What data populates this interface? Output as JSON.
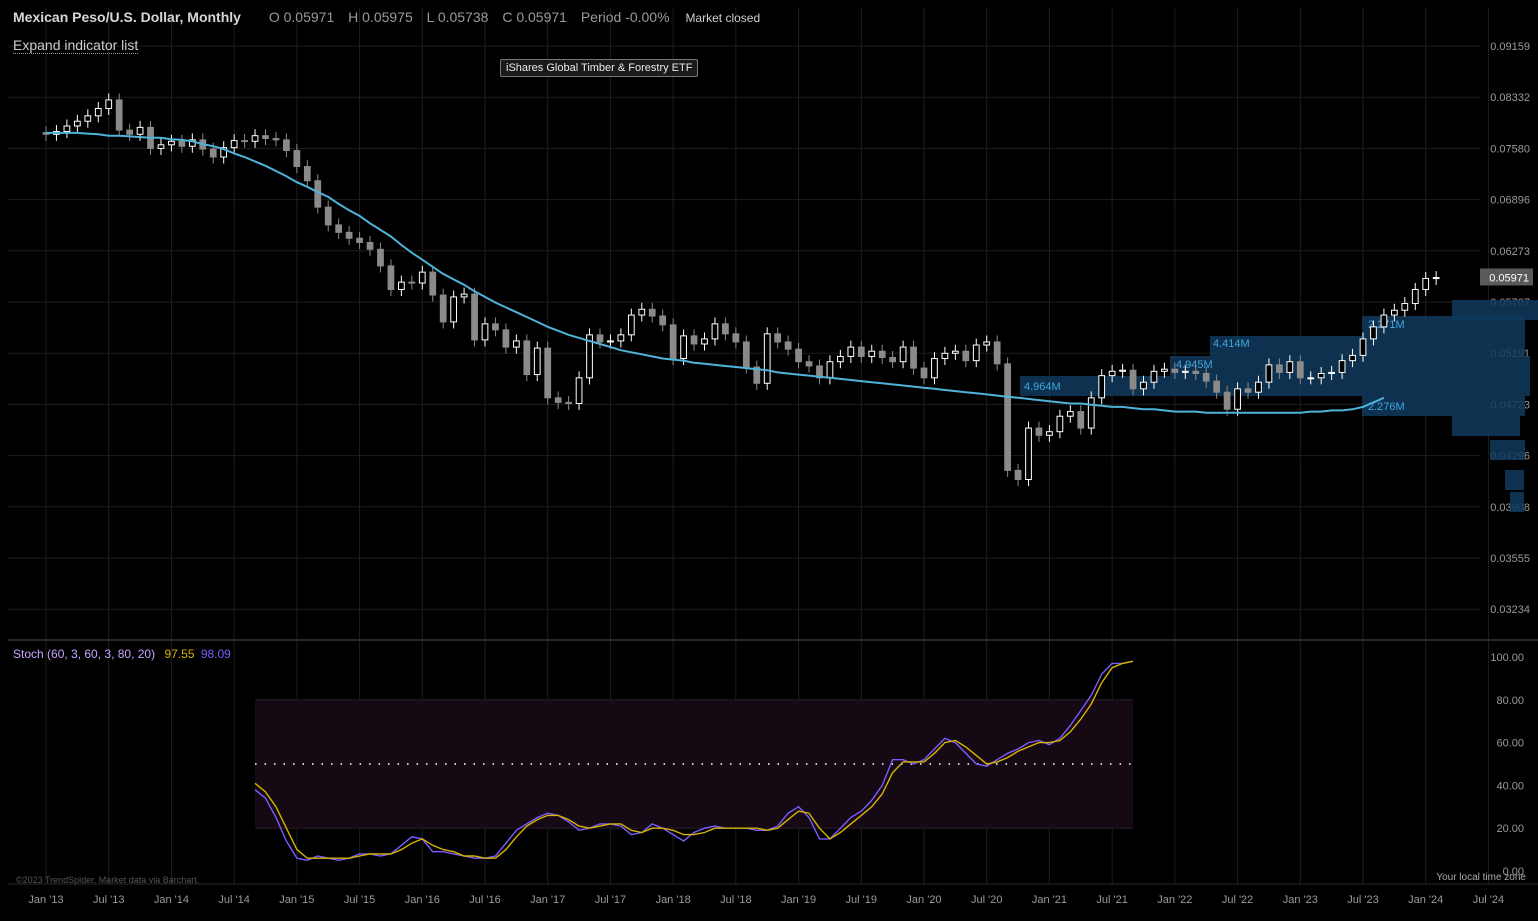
{
  "header": {
    "title": "Mexican Peso/U.S. Dollar, Monthly",
    "o_label": "O",
    "o_value": "0.05971",
    "h_label": "H",
    "h_value": "0.05975",
    "l_label": "L",
    "l_value": "0.05738",
    "c_label": "C",
    "c_value": "0.05971",
    "period_label": "Period",
    "period_value": "-0.00%",
    "status": "Market closed"
  },
  "expand_label": "Expand indicator list",
  "overlay_label": "iShares Global Timber & Forestry ETF",
  "last_price_tag": "0.05971",
  "stoch": {
    "label": "Stoch (60, 3, 60, 3, 80, 20)",
    "k": "97.55",
    "d": "98.09"
  },
  "footer": {
    "copyright": "©2023 TrendSpider. Market data via Barchart.",
    "timezone": "Your local time zone"
  },
  "colors": {
    "bull": "#ffffff",
    "bear": "#8a8a8a",
    "ma": "#4fb3d9",
    "stoch_k": "#7a5cff",
    "stoch_d": "#d8b400",
    "volume_profile": "#0f3a5c",
    "volume_label": "#3fa9e0",
    "grid": "#1e1e1e"
  },
  "chart_data": [
    {
      "type": "candlestick",
      "title": "Mexican Peso/U.S. Dollar, Monthly",
      "y_axis_ticks": [
        "0.09159",
        "0.08332",
        "0.07580",
        "0.06896",
        "0.06273",
        "0.05707",
        "0.05191",
        "0.04723",
        "0.04296",
        "0.03908",
        "0.03555",
        "0.03234"
      ],
      "y_scale": "log",
      "x_axis_ticks": [
        "Jan '13",
        "Jul '13",
        "Jan '14",
        "Jul '14",
        "Jan '15",
        "Jul '15",
        "Jan '16",
        "Jul '16",
        "Jan '17",
        "Jul '17",
        "Jan '18",
        "Jul '18",
        "Jan '19",
        "Jul '19",
        "Jan '20",
        "Jul '20",
        "Jan '21",
        "Jul '21",
        "Jan '22",
        "Jul '22",
        "Jan '23",
        "Jul '23",
        "Jan '24",
        "Jul '24"
      ],
      "close_series": [
        0.0778,
        0.0782,
        0.079,
        0.0797,
        0.0805,
        0.0816,
        0.0829,
        0.0784,
        0.0778,
        0.0788,
        0.0758,
        0.0763,
        0.0768,
        0.0761,
        0.077,
        0.0757,
        0.0746,
        0.0759,
        0.0769,
        0.0768,
        0.0776,
        0.0772,
        0.077,
        0.0755,
        0.0733,
        0.0714,
        0.068,
        0.0658,
        0.0649,
        0.0642,
        0.0637,
        0.0629,
        0.061,
        0.0584,
        0.0592,
        0.0591,
        0.0603,
        0.0578,
        0.055,
        0.0576,
        0.0579,
        0.0532,
        0.0548,
        0.0542,
        0.0525,
        0.0531,
        0.0499,
        0.0524,
        0.0478,
        0.0474,
        0.0473,
        0.0496,
        0.0537,
        0.053,
        0.0531,
        0.0537,
        0.0557,
        0.0563,
        0.0556,
        0.0547,
        0.0514,
        0.0536,
        0.0528,
        0.0533,
        0.0548,
        0.0538,
        0.053,
        0.0506,
        0.0491,
        0.0538,
        0.053,
        0.0523,
        0.0511,
        0.0507,
        0.0496,
        0.0511,
        0.0516,
        0.0525,
        0.0516,
        0.0521,
        0.0515,
        0.0511,
        0.0525,
        0.0505,
        0.0496,
        0.0514,
        0.0519,
        0.0521,
        0.0512,
        0.0527,
        0.053,
        0.0509,
        0.0418,
        0.0411,
        0.0452,
        0.0446,
        0.0449,
        0.0462,
        0.0466,
        0.0452,
        0.0478,
        0.0498,
        0.0502,
        0.0503,
        0.0486,
        0.0492,
        0.0502,
        0.0504,
        0.0501,
        0.0502,
        0.05,
        0.0493,
        0.0483,
        0.0468,
        0.0486,
        0.0483,
        0.0492,
        0.0508,
        0.0501,
        0.0511,
        0.0496,
        0.0496,
        0.05,
        0.0501,
        0.0512,
        0.0517,
        0.0533,
        0.0545,
        0.0557,
        0.0562,
        0.0569,
        0.0584,
        0.0596,
        0.0597
      ],
      "indicators": [
        {
          "name": "Moving average",
          "values": [
            0.078,
            0.078,
            0.078,
            0.078,
            0.0779,
            0.0778,
            0.0776,
            0.0776,
            0.0775,
            0.0774,
            0.0773,
            0.0773,
            0.0771,
            0.077,
            0.0768,
            0.0764,
            0.0761,
            0.0757,
            0.0751,
            0.0746,
            0.074,
            0.0734,
            0.0727,
            0.072,
            0.0712,
            0.0706,
            0.0699,
            0.0693,
            0.0684,
            0.0676,
            0.0669,
            0.066,
            0.0652,
            0.0644,
            0.0634,
            0.0625,
            0.0617,
            0.0609,
            0.0601,
            0.0595,
            0.0589,
            0.0582,
            0.0576,
            0.057,
            0.0565,
            0.056,
            0.0555,
            0.055,
            0.0545,
            0.0541,
            0.0537,
            0.0534,
            0.0531,
            0.0528,
            0.0525,
            0.0522,
            0.052,
            0.0518,
            0.0516,
            0.0514,
            0.0513,
            0.0512,
            0.051,
            0.0509,
            0.0508,
            0.0507,
            0.0506,
            0.0505,
            0.0504,
            0.0503,
            0.0501,
            0.05,
            0.0499,
            0.0498,
            0.0497,
            0.0496,
            0.0495,
            0.0494,
            0.0493,
            0.0492,
            0.0491,
            0.049,
            0.0489,
            0.0488,
            0.0487,
            0.0486,
            0.0485,
            0.0484,
            0.0483,
            0.0482,
            0.0481,
            0.048,
            0.0479,
            0.0478,
            0.0477,
            0.0476,
            0.0475,
            0.0474,
            0.0473,
            0.0473,
            0.0472,
            0.0471,
            0.047,
            0.047,
            0.0469,
            0.0468,
            0.0468,
            0.0467,
            0.0466,
            0.0466,
            0.0466,
            0.0465,
            0.0465,
            0.0465,
            0.0465,
            0.0465,
            0.0465,
            0.0465,
            0.0465,
            0.0465,
            0.0465,
            0.0466,
            0.0466,
            0.0467,
            0.0467,
            0.0468,
            0.047,
            0.0474,
            0.0478
          ]
        }
      ],
      "volume_profile_labels": [
        "2.271M",
        "4.414M",
        "4.945M",
        "4.964M",
        "2.276M"
      ]
    },
    {
      "type": "line",
      "title": "Stoch (60, 3, 60, 3, 80, 20)",
      "y_axis_ticks": [
        "100.00",
        "80.00",
        "60.00",
        "40.00",
        "20.00",
        "0.00"
      ],
      "ylim": [
        0,
        100
      ],
      "bands": [
        20,
        80
      ],
      "midline": 50,
      "x_axis_ticks": [
        "Jan '13",
        "Jul '13",
        "Jan '14",
        "Jul '14",
        "Jan '15",
        "Jul '15",
        "Jan '16",
        "Jul '16",
        "Jan '17",
        "Jul '17",
        "Jan '18",
        "Jul '18",
        "Jan '19",
        "Jul '19",
        "Jan '20",
        "Jul '20",
        "Jan '21",
        "Jul '21",
        "Jan '22",
        "Jul '22",
        "Jan '23",
        "Jul '23",
        "Jan '24",
        "Jul '24"
      ],
      "series": [
        {
          "name": "K",
          "values": [
            38,
            34,
            25,
            14,
            6,
            5,
            7,
            6,
            5,
            6,
            8,
            8,
            7,
            8,
            12,
            16,
            15,
            9,
            9,
            8,
            7,
            6,
            6,
            7,
            13,
            19,
            22,
            25,
            27,
            26,
            23,
            19,
            20,
            22,
            22,
            21,
            17,
            18,
            22,
            20,
            17,
            14,
            18,
            20,
            21,
            20,
            20,
            20,
            19,
            19,
            21,
            27,
            30,
            25,
            15,
            15,
            20,
            25,
            28,
            33,
            40,
            52,
            52,
            50,
            52,
            57,
            62,
            60,
            55,
            50,
            49,
            52,
            55,
            57,
            60,
            61,
            59,
            62,
            68,
            75,
            82,
            92,
            97,
            97,
            98
          ]
        },
        {
          "name": "D",
          "values": [
            41,
            37,
            30,
            20,
            10,
            6,
            6,
            6,
            6,
            6,
            7,
            8,
            8,
            8,
            10,
            13,
            15,
            12,
            10,
            9,
            7,
            7,
            6,
            6,
            10,
            16,
            21,
            24,
            26,
            26,
            24,
            21,
            20,
            21,
            22,
            22,
            19,
            18,
            20,
            20,
            19,
            17,
            17,
            18,
            20,
            20,
            20,
            20,
            20,
            19,
            20,
            24,
            28,
            27,
            20,
            15,
            18,
            22,
            26,
            30,
            36,
            46,
            51,
            51,
            51,
            55,
            60,
            61,
            58,
            54,
            50,
            51,
            53,
            56,
            58,
            60,
            60,
            61,
            65,
            71,
            78,
            88,
            95,
            97,
            98
          ]
        }
      ]
    }
  ]
}
